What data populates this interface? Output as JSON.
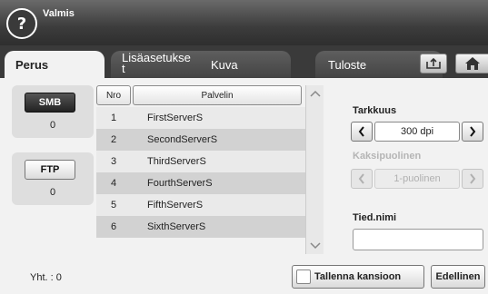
{
  "header": {
    "help_glyph": "?",
    "status": "Valmis"
  },
  "tabs": [
    {
      "label": "Perus",
      "active": true
    },
    {
      "label": "Lisäasetukset",
      "label_display_line1": "Lisäasetukse",
      "label_display_line2": "t",
      "active": false
    },
    {
      "label": "Kuva",
      "active": false
    },
    {
      "label": "Tuloste",
      "active": false
    }
  ],
  "tab_icons": {
    "export": "export-tray-icon",
    "home": "home-icon"
  },
  "protocols": {
    "smb": {
      "label": "SMB",
      "count": "0",
      "selected": true
    },
    "ftp": {
      "label": "FTP",
      "count": "0",
      "selected": false
    }
  },
  "server_table": {
    "headers": {
      "nro": "Nro",
      "palvelin": "Palvelin"
    },
    "rows": [
      {
        "nro": "1",
        "name": "FirstServerS"
      },
      {
        "nro": "2",
        "name": "SecondServerS"
      },
      {
        "nro": "3",
        "name": "ThirdServerS"
      },
      {
        "nro": "4",
        "name": "FourthServerS"
      },
      {
        "nro": "5",
        "name": "FifthServerS"
      },
      {
        "nro": "6",
        "name": "SixthServerS"
      }
    ]
  },
  "settings": {
    "resolution": {
      "label": "Tarkkuus",
      "value": "300 dpi"
    },
    "duplex": {
      "label": "Kaksipuolinen",
      "value": "1-puolinen",
      "enabled": false
    },
    "filename": {
      "label": "Tied.nimi",
      "value": ""
    }
  },
  "footer": {
    "total": "Yht. : 0",
    "save_to_folder": "Tallenna kansioon",
    "previous": "Edellinen"
  },
  "colors": {
    "header_bg": "#3c3c3c",
    "content_bg": "#f2f2f2",
    "row_light": "#eaeaea",
    "row_dark": "#d2d2d2",
    "disabled_text": "#b0b0b0"
  }
}
